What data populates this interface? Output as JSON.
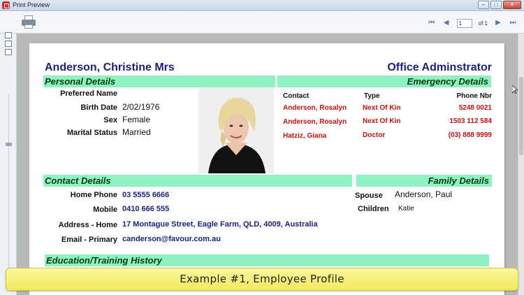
{
  "window": {
    "title": "Print Preview",
    "btn_min": "–",
    "btn_max": "□",
    "btn_close": "✕"
  },
  "toolbar": {
    "print_icon": "printer-icon",
    "first_icon": "first-page-icon",
    "prev_icon": "prev-page-icon",
    "next_icon": "next-page-icon",
    "last_icon": "last-page-icon",
    "page_value": "1",
    "page_of": "of 1"
  },
  "report": {
    "name": "Anderson, Christine Mrs",
    "job_title": "Office Adminstrator",
    "personal": {
      "heading": "Personal Details",
      "preferred_label": "Preferred Name",
      "birth_label": "Birth Date",
      "birth_value": "2/02/1976",
      "sex_label": "Sex",
      "sex_value": "Female",
      "marital_label": "Marital Status",
      "marital_value": "Married"
    },
    "emergency": {
      "heading": "Emergency Details",
      "col_contact": "Contact",
      "col_type": "Type",
      "col_phone": "Phone Nbr",
      "rows": [
        {
          "contact": "Anderson, Rosalyn",
          "type": "Next Of Kin",
          "phone": "5248 0021"
        },
        {
          "contact": "Anderson, Rosalyn",
          "type": "Next Of Kin",
          "phone": "1503 112 584"
        },
        {
          "contact": "Hatziz, Giana",
          "type": "Doctor",
          "phone": "(03) 888 9999"
        }
      ]
    },
    "contact": {
      "heading": "Contact Details",
      "home_label": "Home Phone",
      "home_value": "03 5555 6666",
      "mobile_label": "Mobile",
      "mobile_value": "0410 666 555",
      "address_label": "Address - Home",
      "address_value": "17 Montague Street, Eagle Farm, QLD, 4009, Australia",
      "email_label": "Email - Primary",
      "email_value": "canderson@favour.com.au"
    },
    "family": {
      "heading": "Family Details",
      "spouse_label": "Spouse",
      "spouse_value": "Anderson, Paul",
      "children_label": "Children",
      "children_value": "Katie"
    },
    "education": {
      "heading": "Education/Training History"
    }
  },
  "caption": "Example #1, Employee Profile",
  "colors": {
    "band": "#8ef2c3",
    "title_blue": "#1b1f7d",
    "emergency_red": "#cc1111",
    "caption_yellow": "#f2ea5a"
  }
}
